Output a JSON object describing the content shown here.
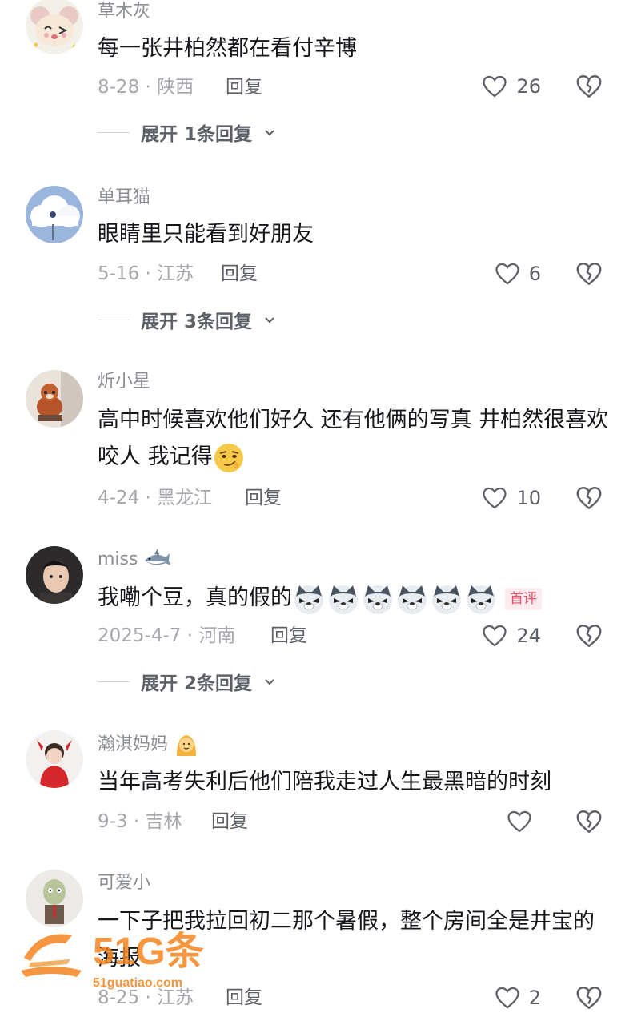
{
  "comments": [
    {
      "username": "草木灰",
      "content": "每一张井柏然都在看付辛博",
      "date_loc": "8-28 · 陕西",
      "reply": "回复",
      "likes": "26",
      "expand": "展开 1条回复",
      "avatar": "cartoon-mouse-icon"
    },
    {
      "username": "单耳猫",
      "content": "眼睛里只能看到好朋友",
      "date_loc": "5-16 · 江苏",
      "reply": "回复",
      "likes": "6",
      "expand": "展开 3条回复",
      "avatar": "cloud-scene-icon"
    },
    {
      "username": "炘小星",
      "content": "高中时候喜欢他们好久 还有他俩的写真 井柏然很喜欢咬人 我记得",
      "date_loc": "4-24 · 黑龙江",
      "reply": "回复",
      "likes": "10",
      "avatar": "red-panda-photo"
    },
    {
      "username": "miss",
      "username_emoji": "shark-emoji",
      "content": "我嘞个豆，真的假的",
      "badge": "首评",
      "date_loc": "2025-4-7 · 河南",
      "reply": "回复",
      "likes": "24",
      "expand": "展开 2条回复",
      "avatar": "person-photo"
    },
    {
      "username": "瀚淇妈妈",
      "username_emoji": "person-emoji",
      "content": "当年高考失利后他们陪我走过人生最黑暗的时刻",
      "date_loc": "9-3 · 吉林",
      "reply": "回复",
      "likes": "",
      "avatar": "child-photo"
    },
    {
      "username": "可爱小",
      "content": "一下子把我拉回初二那个暑假，整个房间全是井宝的海报",
      "date_loc": "8-25 · 江苏",
      "reply": "回复",
      "likes": "2",
      "avatar": "zombie-cartoon-icon"
    }
  ],
  "watermark": {
    "brand": "51G条",
    "url": "51guatiao.com"
  },
  "colors": {
    "text": "#16171b",
    "meta": "#a5a7ad",
    "badge": "#ef4f6a",
    "watermark": "#f5841f"
  }
}
